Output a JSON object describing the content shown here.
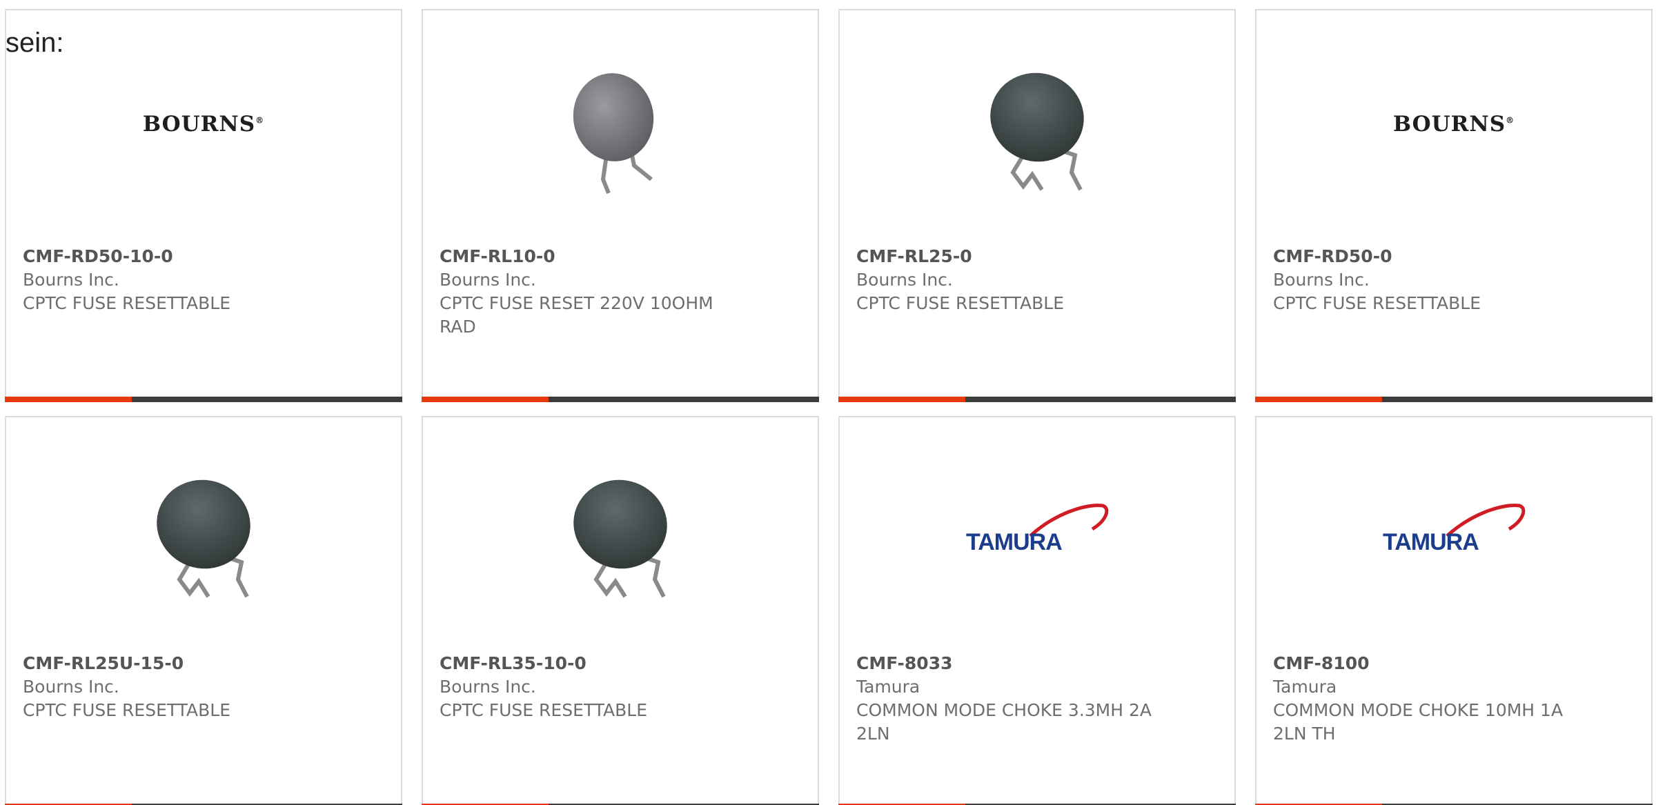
{
  "intro_text": "sein:",
  "logos": {
    "bourns": "BOURNS",
    "bourns_mark": "®",
    "tamura": "TAMURA"
  },
  "colors": {
    "accent": "#e8380d",
    "bar": "#3c3c3c",
    "card_border": "#dcdcdc",
    "tamura_blue": "#1c3c8c",
    "tamura_red": "#d01c24"
  },
  "products": [
    {
      "part": "CMF-RD50-10-0",
      "manufacturer": "Bourns Inc.",
      "description": "CPTC FUSE RESETTABLE",
      "media": "bourns-logo"
    },
    {
      "part": "CMF-RL10-0",
      "manufacturer": "Bourns Inc.",
      "description": "CPTC FUSE RESET 220V 10OHM RAD",
      "media": "thermistor-photo-gray"
    },
    {
      "part": "CMF-RL25-0",
      "manufacturer": "Bourns Inc.",
      "description": "CPTC FUSE RESETTABLE",
      "media": "thermistor-photo-dark"
    },
    {
      "part": "CMF-RD50-0",
      "manufacturer": "Bourns Inc.",
      "description": "CPTC FUSE RESETTABLE",
      "media": "bourns-logo"
    },
    {
      "part": "CMF-RL25U-15-0",
      "manufacturer": "Bourns Inc.",
      "description": "CPTC FUSE RESETTABLE",
      "media": "thermistor-photo-dark"
    },
    {
      "part": "CMF-RL35-10-0",
      "manufacturer": "Bourns Inc.",
      "description": "CPTC FUSE RESETTABLE",
      "media": "thermistor-photo-dark"
    },
    {
      "part": "CMF-8033",
      "manufacturer": "Tamura",
      "description": "COMMON MODE CHOKE 3.3MH 2A 2LN",
      "media": "tamura-logo"
    },
    {
      "part": "CMF-8100",
      "manufacturer": "Tamura",
      "description": "COMMON MODE CHOKE 10MH 1A 2LN TH",
      "media": "tamura-logo"
    }
  ]
}
